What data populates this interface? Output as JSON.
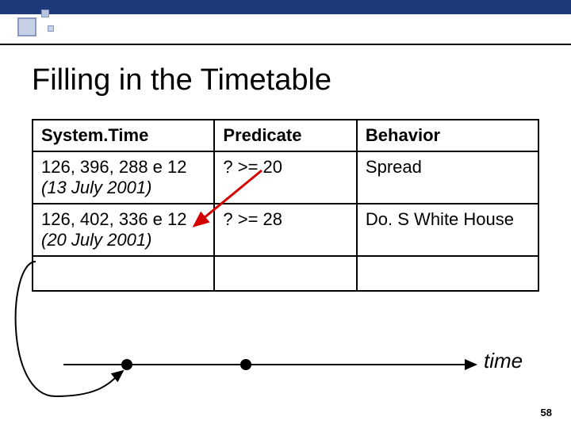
{
  "title": "Filling in the Timetable",
  "table": {
    "headers": {
      "col1": "System.Time",
      "col2": "Predicate",
      "col3": "Behavior"
    },
    "rows": [
      {
        "time": "126, 396, 288 e 12",
        "time_note": "(13 July 2001)",
        "predicate": "? >= 20",
        "behavior": "Spread"
      },
      {
        "time": "126, 402, 336 e 12",
        "time_note": "(20 July 2001)",
        "predicate": "? >= 28",
        "behavior": "Do. S White House"
      }
    ]
  },
  "timeline_label": "time",
  "page_number": "58"
}
